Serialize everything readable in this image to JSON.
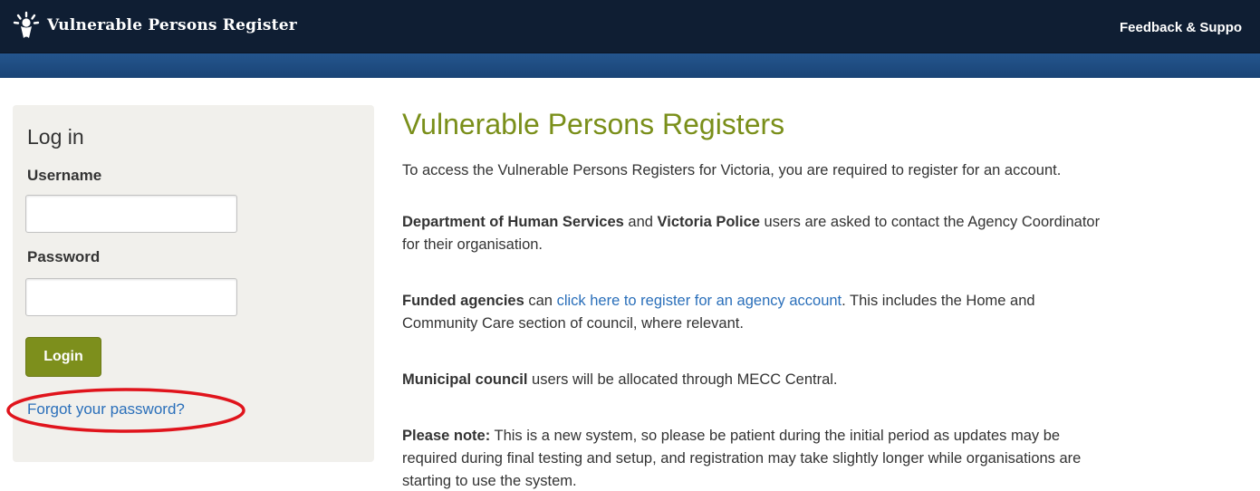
{
  "header": {
    "site_title": "Vulnerable Persons Register",
    "feedback_link": "Feedback & Suppo",
    "logo_icon": "sun-figure-icon"
  },
  "colors": {
    "header_bg": "#0f1e33",
    "subbar_bg": "#1f4d82",
    "accent_green": "#7d8f1c",
    "title_green": "#7a8f1a",
    "link_blue": "#2a6fba",
    "panel_bg": "#f1f0ec",
    "annotation_red": "#e0141c"
  },
  "login": {
    "heading": "Log in",
    "username_label": "Username",
    "username_value": "",
    "password_label": "Password",
    "password_value": "",
    "login_button": "Login",
    "forgot_link": "Forgot your password?"
  },
  "content": {
    "title": "Vulnerable Persons Registers",
    "intro": "To access the Vulnerable Persons Registers for Victoria, you are required to register for an account.",
    "dhs_bold1": "Department of Human Services",
    "dhs_and": " and ",
    "dhs_bold2": "Victoria Police",
    "dhs_line1_rest": " users are asked to contact the Agency Coordinator",
    "dhs_line2": "for their organisation.",
    "funded_bold": "Funded agencies",
    "funded_can": " can ",
    "funded_link": "click here to register for an agency account",
    "funded_line1_rest": ". This includes the Home and",
    "funded_line2": "Community Care section of council, where relevant.",
    "municipal_bold": "Municipal council",
    "municipal_rest": " users will be allocated through MECC Central.",
    "note_bold": "Please note:",
    "note_line1_rest": " This is a new system, so please be patient during the initial period as updates may be",
    "note_line2": "required during final testing and setup, and registration may take slightly longer while organisations are",
    "note_line3": "starting to use the system."
  }
}
